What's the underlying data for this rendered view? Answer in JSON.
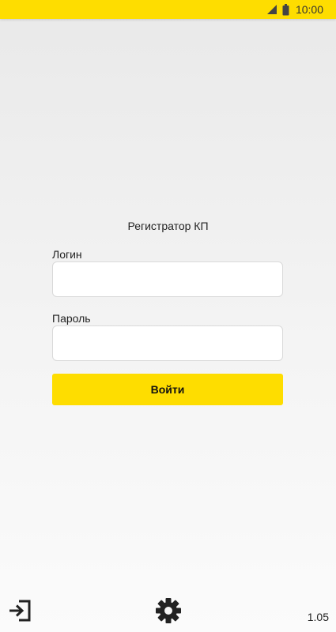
{
  "status_bar": {
    "time": "10:00",
    "icons": [
      "signal-icon",
      "battery-icon"
    ],
    "background": "#fedd00"
  },
  "app": {
    "title": "Регистратор КП"
  },
  "form": {
    "login_label": "Логин",
    "login_value": "",
    "password_label": "Пароль",
    "password_value": "",
    "submit_label": "Войти",
    "accent_color": "#fedd00"
  },
  "footer": {
    "icons": [
      "exit-icon",
      "gear-icon"
    ],
    "version": "1.05"
  }
}
